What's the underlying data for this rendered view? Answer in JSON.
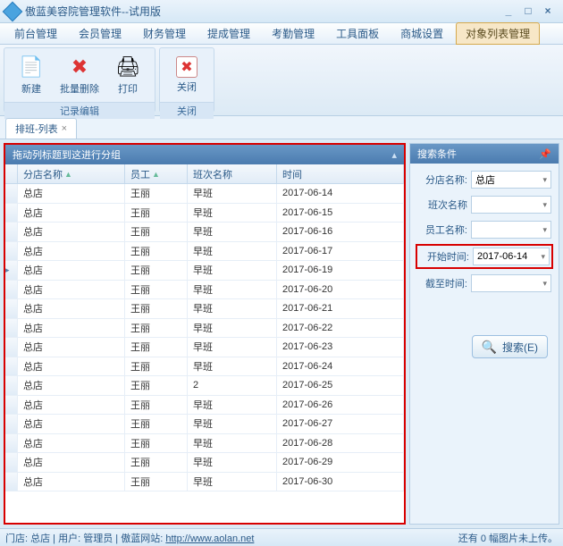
{
  "window": {
    "title": "傲蓝美容院管理软件--试用版"
  },
  "menu": {
    "items": [
      "前台管理",
      "会员管理",
      "财务管理",
      "提成管理",
      "考勤管理",
      "工具面板",
      "商城设置",
      "对象列表管理"
    ],
    "active_index": 7
  },
  "ribbon": {
    "groups": [
      {
        "label": "记录编辑",
        "buttons": [
          {
            "id": "new",
            "label": "新建",
            "icon": "📄"
          },
          {
            "id": "batch-del",
            "label": "批量删除",
            "icon": "✖",
            "color": "#d33"
          },
          {
            "id": "print",
            "label": "打印",
            "icon": "🖨"
          }
        ]
      },
      {
        "label": "关闭",
        "buttons": [
          {
            "id": "close",
            "label": "关闭",
            "icon": "✖",
            "boxed": true,
            "color": "#d33"
          }
        ]
      }
    ]
  },
  "subtab": {
    "label": "排班-列表"
  },
  "group_bar": {
    "text": "拖动列标题到这进行分组"
  },
  "grid": {
    "columns": [
      "分店名称",
      "员工",
      "班次名称",
      "时间"
    ],
    "rows": [
      {
        "store": "总店",
        "emp": "王丽",
        "shift": "早班",
        "date": "2017-06-14"
      },
      {
        "store": "总店",
        "emp": "王丽",
        "shift": "早班",
        "date": "2017-06-15"
      },
      {
        "store": "总店",
        "emp": "王丽",
        "shift": "早班",
        "date": "2017-06-16"
      },
      {
        "store": "总店",
        "emp": "王丽",
        "shift": "早班",
        "date": "2017-06-17"
      },
      {
        "store": "总店",
        "emp": "王丽",
        "shift": "早班",
        "date": "2017-06-19",
        "current": true
      },
      {
        "store": "总店",
        "emp": "王丽",
        "shift": "早班",
        "date": "2017-06-20"
      },
      {
        "store": "总店",
        "emp": "王丽",
        "shift": "早班",
        "date": "2017-06-21"
      },
      {
        "store": "总店",
        "emp": "王丽",
        "shift": "早班",
        "date": "2017-06-22"
      },
      {
        "store": "总店",
        "emp": "王丽",
        "shift": "早班",
        "date": "2017-06-23"
      },
      {
        "store": "总店",
        "emp": "王丽",
        "shift": "早班",
        "date": "2017-06-24"
      },
      {
        "store": "总店",
        "emp": "王丽",
        "shift": "2",
        "date": "2017-06-25"
      },
      {
        "store": "总店",
        "emp": "王丽",
        "shift": "早班",
        "date": "2017-06-26"
      },
      {
        "store": "总店",
        "emp": "王丽",
        "shift": "早班",
        "date": "2017-06-27"
      },
      {
        "store": "总店",
        "emp": "王丽",
        "shift": "早班",
        "date": "2017-06-28"
      },
      {
        "store": "总店",
        "emp": "王丽",
        "shift": "早班",
        "date": "2017-06-29"
      },
      {
        "store": "总店",
        "emp": "王丽",
        "shift": "早班",
        "date": "2017-06-30"
      }
    ]
  },
  "search": {
    "title": "搜索条件",
    "fields": {
      "store": {
        "label": "分店名称:",
        "value": "总店"
      },
      "shift": {
        "label": "班次名称",
        "value": ""
      },
      "emp": {
        "label": "员工名称:",
        "value": ""
      },
      "start": {
        "label": "开始时间:",
        "value": "2017-06-14"
      },
      "end": {
        "label": "截至时间:",
        "value": ""
      }
    },
    "button": "搜索(E)"
  },
  "status": {
    "left_store_label": "门店:",
    "left_store": "总店",
    "left_user_label": "用户:",
    "left_user": "管理员",
    "left_site_label": "傲蓝网站:",
    "left_site_url": "http://www.aolan.net",
    "right": "还有 0 幅图片未上传。"
  }
}
